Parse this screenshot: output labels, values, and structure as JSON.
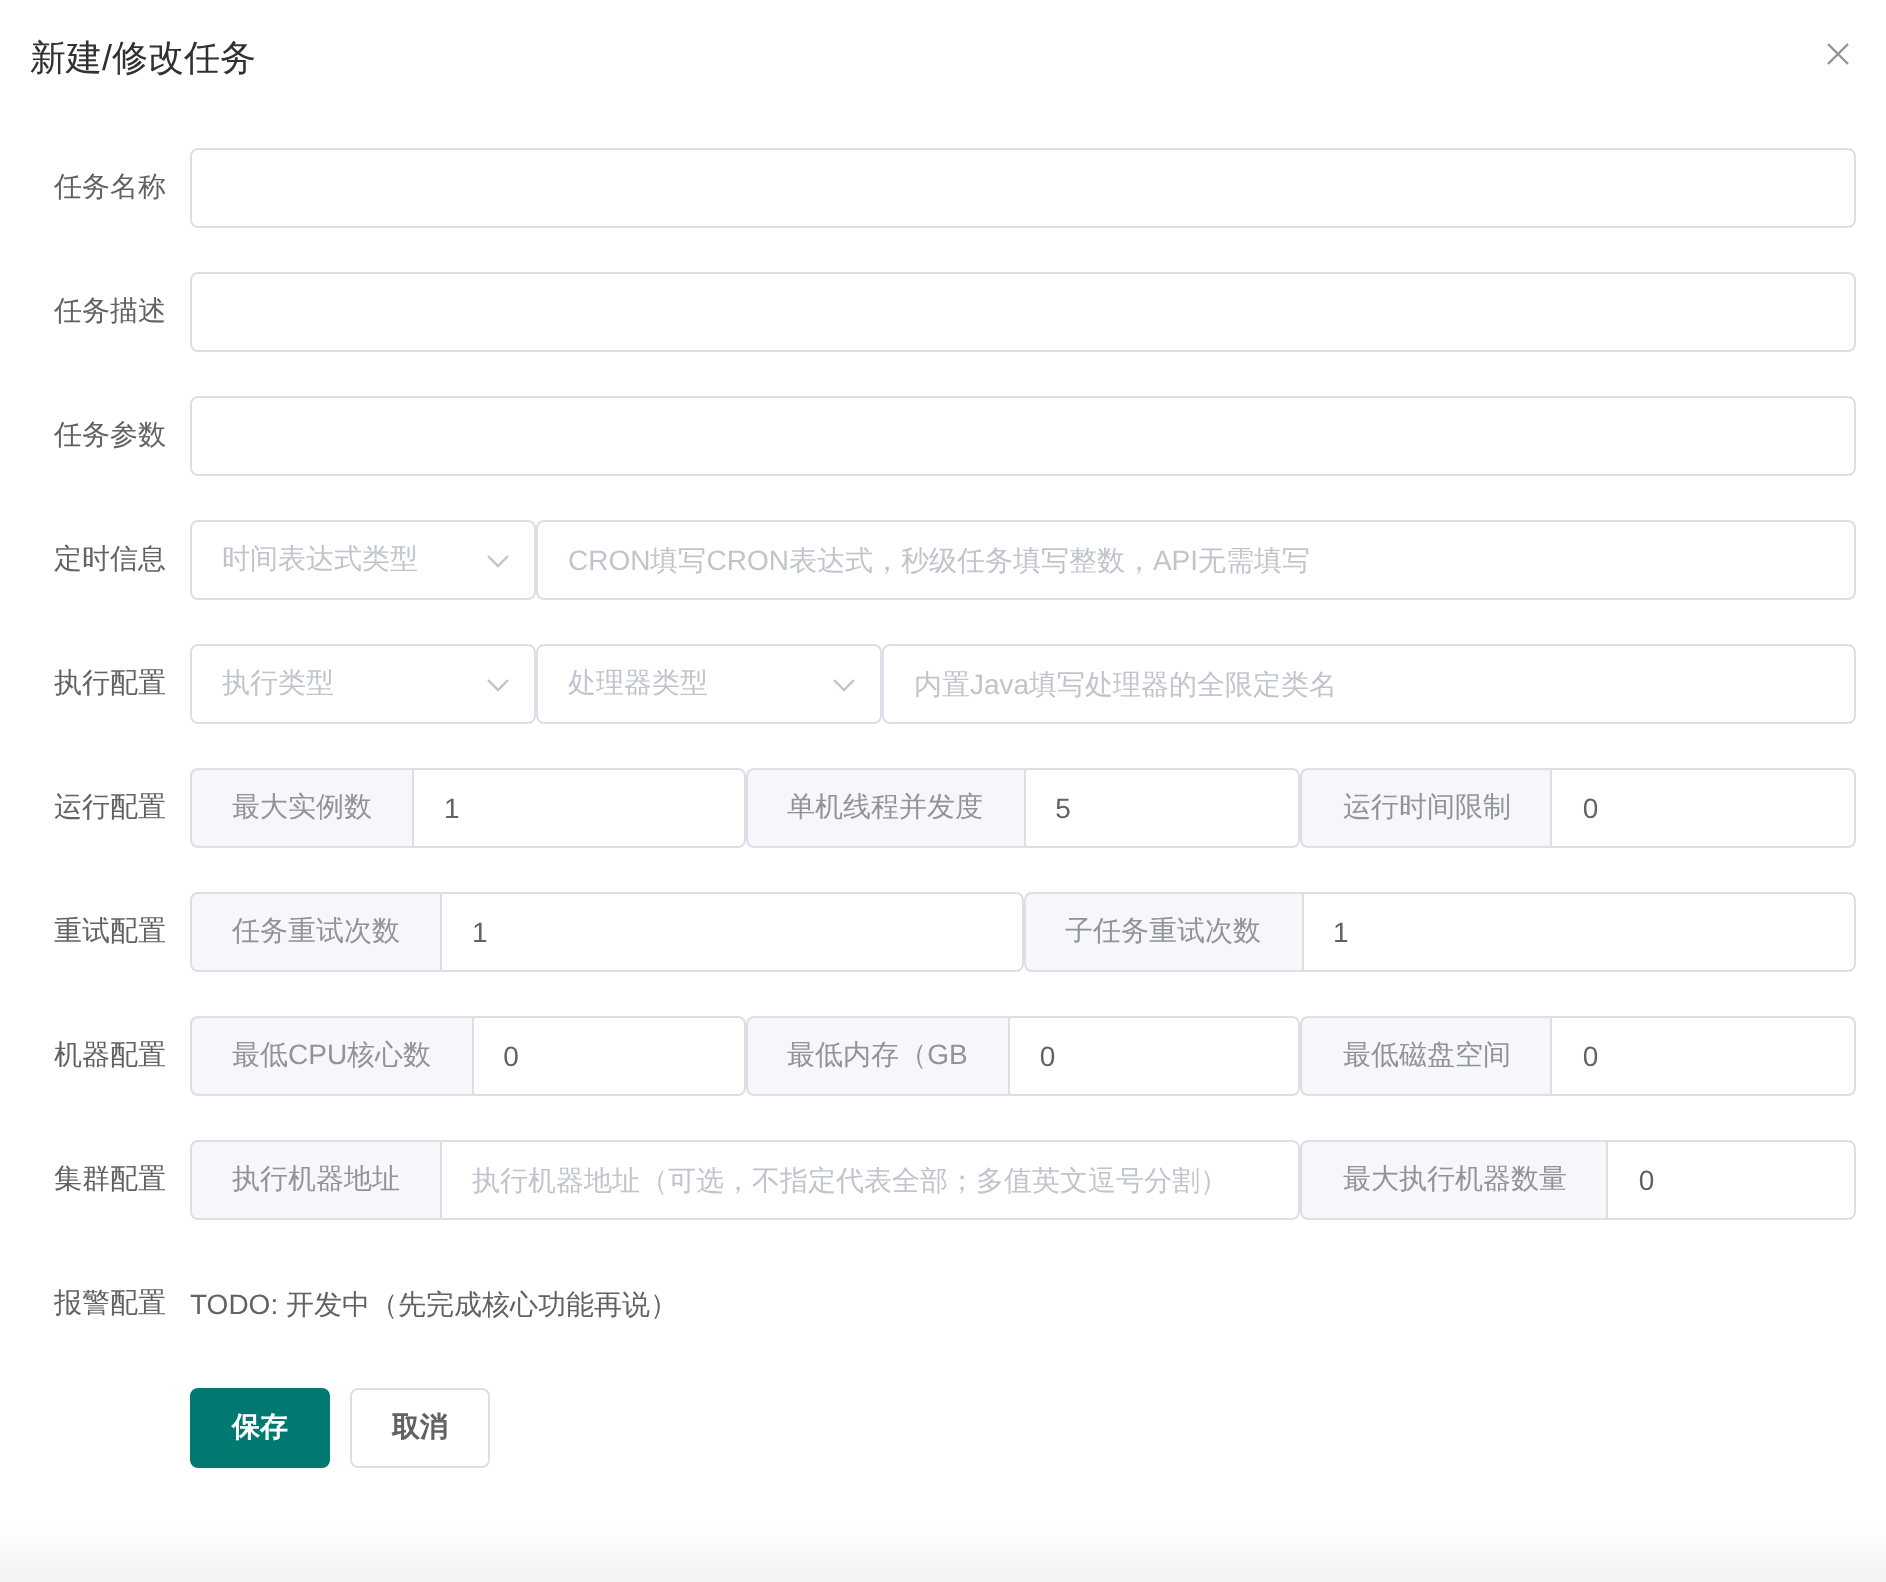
{
  "dialog": {
    "title": "新建/修改任务"
  },
  "form": {
    "rows": [
      {
        "label": "任务名称",
        "parts": [
          {
            "kind": "input"
          }
        ]
      },
      {
        "label": "任务描述",
        "parts": [
          {
            "kind": "input"
          }
        ]
      },
      {
        "label": "任务参数",
        "parts": [
          {
            "kind": "input"
          }
        ]
      },
      {
        "label": "定时信息",
        "parts": [
          {
            "kind": "select",
            "placeholder": "时间表达式类型"
          },
          {
            "kind": "input",
            "placeholder": "CRON填写CRON表达式，秒级任务填写整数，API无需填写"
          }
        ]
      },
      {
        "label": "执行配置",
        "parts": [
          {
            "kind": "select",
            "placeholder": "执行类型"
          },
          {
            "kind": "select",
            "placeholder": "处理器类型"
          },
          {
            "kind": "input",
            "placeholder": "内置Java填写处理器的全限定类名"
          }
        ]
      },
      {
        "label": "运行配置",
        "parts": [
          {
            "kind": "addon",
            "addon": "最大实例数",
            "value": "1"
          },
          {
            "kind": "addon",
            "addon": "单机线程并发度",
            "value": "5"
          },
          {
            "kind": "addon",
            "addon": "运行时间限制",
            "value": "0"
          }
        ]
      },
      {
        "label": "重试配置",
        "parts": [
          {
            "kind": "addon",
            "addon": "任务重试次数",
            "value": "1"
          },
          {
            "kind": "addon",
            "addon": "子任务重试次数",
            "value": "1"
          }
        ]
      },
      {
        "label": "机器配置",
        "parts": [
          {
            "kind": "addon",
            "addon": "最低CPU核心数",
            "value": "0"
          },
          {
            "kind": "addon",
            "addon": "最低内存（GB",
            "value": "0"
          },
          {
            "kind": "addon",
            "addon": "最低磁盘空间",
            "value": "0"
          }
        ]
      },
      {
        "label": "集群配置",
        "parts": [
          {
            "kind": "addon",
            "addon": "执行机器地址",
            "placeholder": "执行机器地址（可选，不指定代表全部；多值英文逗号分割）"
          },
          {
            "kind": "addon",
            "addon": "最大执行机器数量",
            "value": "0"
          }
        ]
      },
      {
        "label": "报警配置",
        "parts": [
          {
            "kind": "text",
            "text": "TODO: 开发中（先完成核心功能再说）"
          }
        ]
      }
    ]
  },
  "buttons": [
    {
      "label": "保存",
      "kind": "primary"
    },
    {
      "label": "取消",
      "kind": "default"
    }
  ]
}
